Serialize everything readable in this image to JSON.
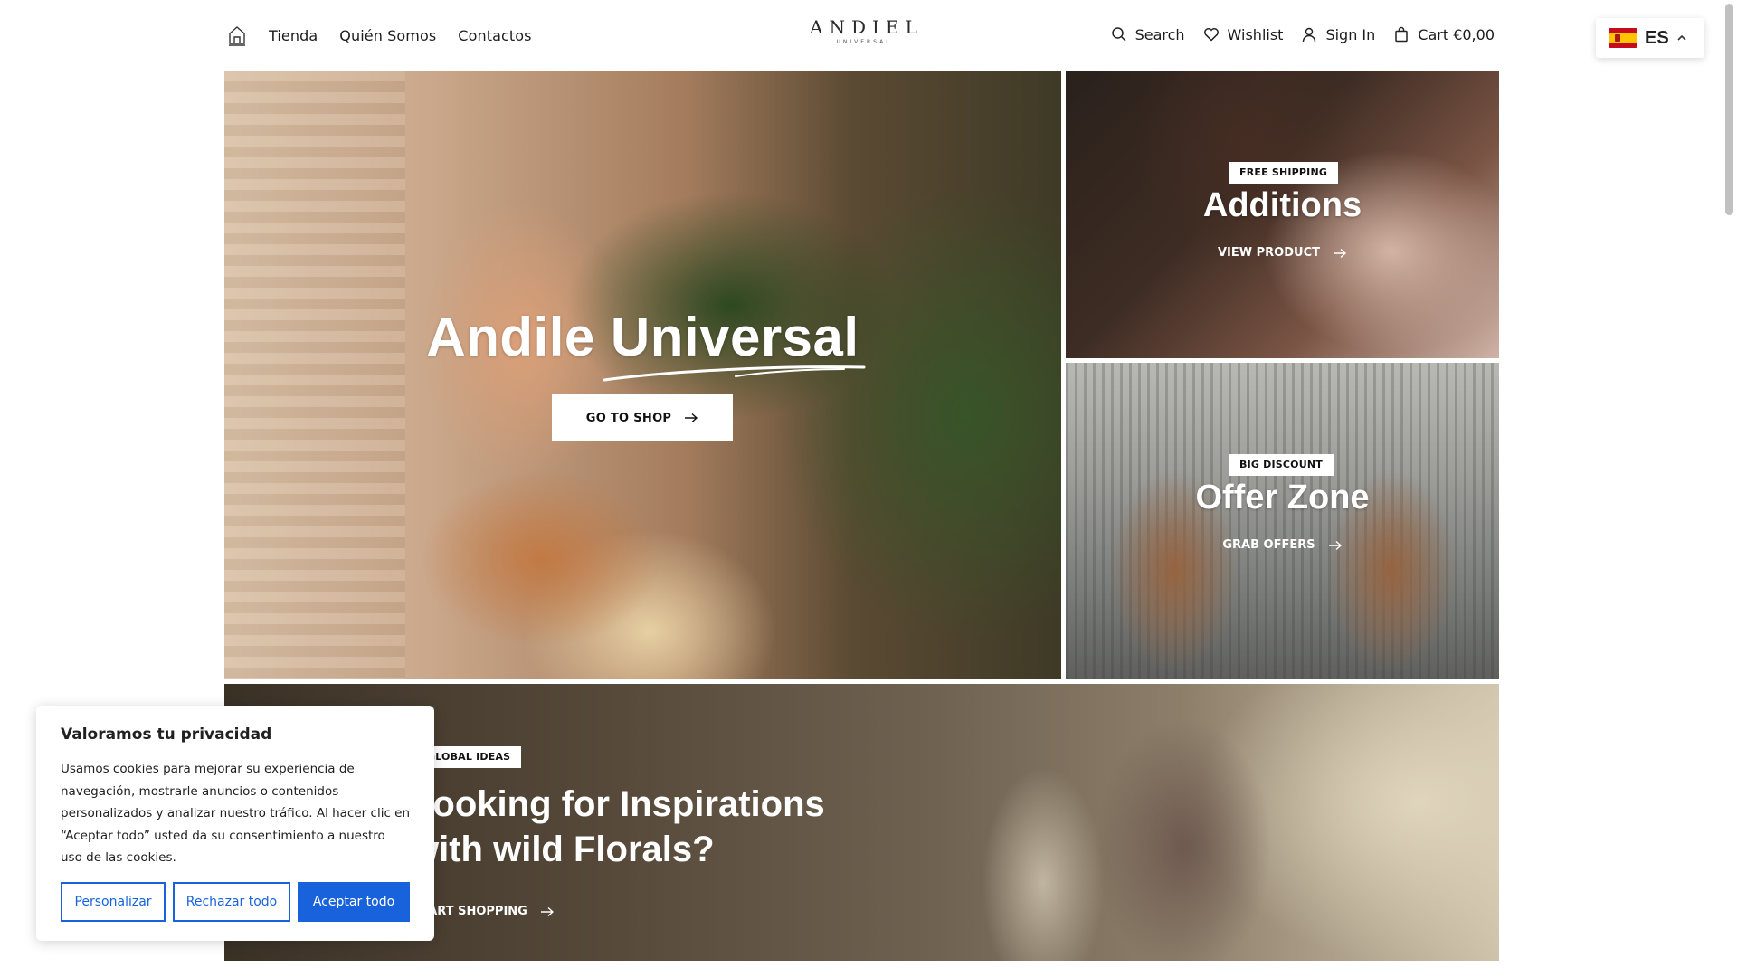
{
  "header": {
    "nav": [
      "Tienda",
      "Quién Somos",
      "Contactos"
    ],
    "logo": {
      "brand": "ANDIEL",
      "tagline": "UNIVERSAL"
    },
    "utilities": {
      "search": "Search",
      "wishlist": "Wishlist",
      "signin": "Sign In",
      "cart": "Cart €0,00"
    }
  },
  "language": {
    "code": "ES"
  },
  "hero": {
    "title": "Andile Universal",
    "button": "GO TO SHOP"
  },
  "promo_additions": {
    "badge": "FREE SHIPPING",
    "title": "Additions",
    "link": "VIEW PRODUCT"
  },
  "promo_offer": {
    "badge": "BIG DISCOUNT",
    "title": "Offer Zone",
    "link": "GRAB OFFERS"
  },
  "promo_florals": {
    "badge": "GLOBAL IDEAS",
    "title_line1": "Looking for Inspirations",
    "title_line2": "with wild Florals?",
    "link": "START SHOPPING"
  },
  "cookie": {
    "title": "Valoramos tu privacidad",
    "text": "Usamos cookies para mejorar su experiencia de navegación, mostrarle anuncios o contenidos personalizados y analizar nuestro tráfico. Al hacer clic en “Aceptar todo” usted da su consentimiento a nuestro uso de las cookies.",
    "customize": "Personalizar",
    "reject": "Rechazar todo",
    "accept": "Aceptar todo"
  },
  "colors": {
    "accent": "#1863dc",
    "text": "#1c1c1c"
  }
}
